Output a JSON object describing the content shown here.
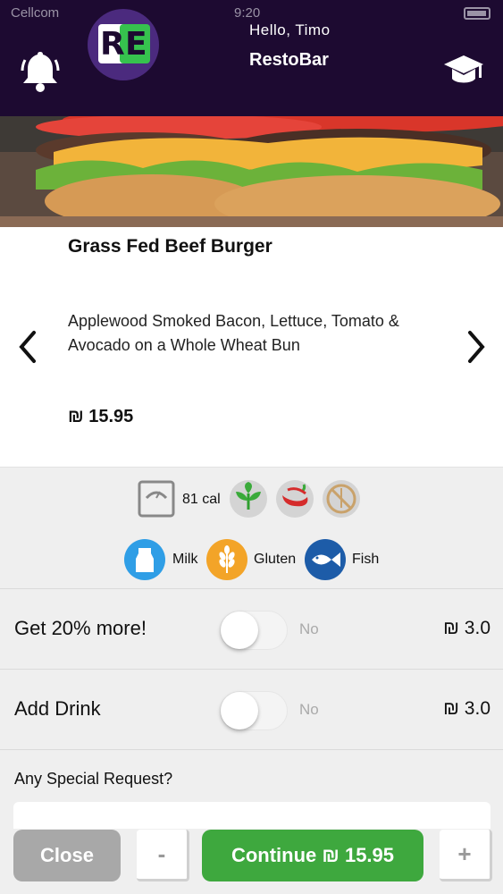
{
  "status_bar": {
    "carrier": "Cellcom",
    "time": "9:20"
  },
  "header": {
    "greeting": "Hello,  Timo",
    "app_name": "RestoBar",
    "logo_letters": [
      "R",
      "E"
    ],
    "notification_icon": "bell-icon",
    "profile_icon": "graduation-cap-icon"
  },
  "item": {
    "title": "Grass Fed Beef Burger",
    "description": "Applewood Smoked Bacon, Lettuce, Tomato & Avocado on a Whole Wheat Bun",
    "price": "₪ 15.95",
    "hero_image": "burger-photo"
  },
  "nutrition": {
    "calories": "81 cal",
    "icons": [
      "scale-icon",
      "vegetarian-leaf-icon",
      "spicy-pepper-icon",
      "no-wheat-icon"
    ]
  },
  "allergens": [
    {
      "label": "Milk",
      "icon": "milk-bottle-icon",
      "color": "#2f9ee6"
    },
    {
      "label": "Gluten",
      "icon": "wheat-icon",
      "color": "#f3a428"
    },
    {
      "label": "Fish",
      "icon": "fish-icon",
      "color": "#1d5ca8"
    }
  ],
  "options": [
    {
      "label": "Get 20% more!",
      "state": "No",
      "price": "₪ 3.0",
      "enabled": false
    },
    {
      "label": "Add Drink",
      "state": "No",
      "price": "₪ 3.0",
      "enabled": false
    }
  ],
  "special_request": {
    "label": "Any Special Request?",
    "value": ""
  },
  "actions": {
    "close": "Close",
    "decrement": "-",
    "continue": "Continue ₪ 15.95",
    "increment": "+"
  },
  "colors": {
    "header_bg": "#1d0a31",
    "continue_green": "#3ea83e",
    "close_gray": "#a8a8a8"
  }
}
